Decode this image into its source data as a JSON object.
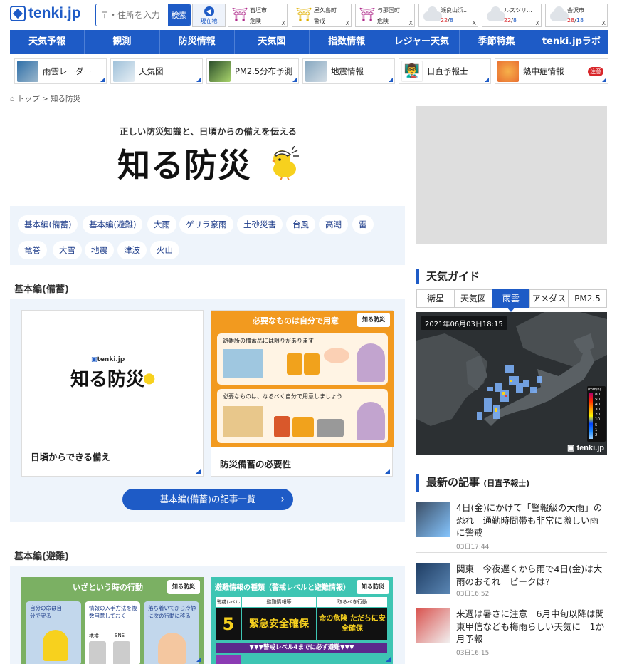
{
  "header": {
    "logo": "tenki.jp",
    "search_placeholder": "〒・住所を入力",
    "search_button": "検索",
    "location_button": "現在地"
  },
  "warnings": [
    {
      "place": "石垣市",
      "status": "危険",
      "type": "warn"
    },
    {
      "place": "屋久島町",
      "status": "警戒",
      "type": "warn"
    },
    {
      "place": "与那国町",
      "status": "危険",
      "type": "warn"
    },
    {
      "place": "瀬良山浜...",
      "high": "22",
      "low": "8",
      "type": "cloud"
    },
    {
      "place": "ルスツリ...",
      "high": "22",
      "low": "8",
      "type": "cloud"
    },
    {
      "place": "会沢市",
      "high": "28",
      "low": "18",
      "type": "cloud"
    }
  ],
  "close_mark": "X",
  "nav": [
    "天気予報",
    "観測",
    "防災情報",
    "天気図",
    "指数情報",
    "レジャー天気",
    "季節特集",
    "tenki.jpラボ"
  ],
  "subnav": [
    {
      "label": "雨雲レーダー"
    },
    {
      "label": "天気図"
    },
    {
      "label": "PM2.5分布予測"
    },
    {
      "label": "地震情報"
    },
    {
      "label": "日直予報士"
    },
    {
      "label": "熱中症情報",
      "badge": "注意"
    }
  ],
  "breadcrumb": {
    "home": "トップ",
    "sep": ">",
    "current": "知る防災"
  },
  "hero": {
    "subtitle": "正しい防災知識と、日頃からの備えを伝える",
    "title": "知る防災"
  },
  "tags": [
    "基本編(備蓄)",
    "基本編(避難)",
    "大雨",
    "ゲリラ豪雨",
    "土砂災害",
    "台風",
    "高潮",
    "雷",
    "竜巻",
    "大雪",
    "地震",
    "津波",
    "火山"
  ],
  "section1": {
    "heading": "基本編(備蓄)",
    "card1_caption": "日頃からできる備え",
    "card1_logo_small": "tenki.jp",
    "card1_logo": "知る防災",
    "card2_caption": "防災備蓄の必要性",
    "card2_banner": "必要なものは自分で用意",
    "card2_line1": "避難所の備蓄品には限りがあります",
    "card2_line2": "必要なものは、なるべく自分で用意しましょう",
    "card2_logo": "知る防災",
    "button": "基本編(備蓄)の記事一覧"
  },
  "section2": {
    "heading": "基本編(避難)",
    "card1_banner": "いざという時の行動",
    "card1_b1": "自分の命は自分で守る",
    "card1_b2": "情報の入手方法を複数用意しておく",
    "card1_b3": "落ち着いてから冷静に次の行動に移る",
    "card1_phone1": "携帯",
    "card1_phone2": "SNS",
    "card2_banner": "避難情報の種類（警戒レベルと避難情報）",
    "card2_h1": "警戒レベル",
    "card2_h2": "避難情報等",
    "card2_h3": "取るべき行動",
    "card2_level": "5",
    "card2_info": "緊急安全確保",
    "card2_action": "命の危険 ただちに安全確保",
    "card2_strip": "▼▼▼警戒レベル4までに必ず避難▼▼▼",
    "logo": "知る防災"
  },
  "guide": {
    "heading": "天気ガイド",
    "tabs": [
      "衛星",
      "天気図",
      "雨雲",
      "アメダス",
      "PM2.5"
    ],
    "active_tab": "雨雲",
    "map_time": "2021年06月03日18:15",
    "map_logo": "tenki.jp",
    "legend_unit": "(mm/h)",
    "legend": [
      "80",
      "50",
      "40",
      "30",
      "20",
      "10",
      "5",
      "1",
      "2"
    ]
  },
  "latest": {
    "heading": "最新の記事",
    "sub": "(日直予報士)",
    "articles": [
      {
        "title": "4日(金)にかけて「警報級の大雨」の恐れ　通勤時間帯も非常に激しい雨に警戒",
        "date": "03日17:44"
      },
      {
        "title": "関東　今夜遅くから雨で4日(金)は大雨のおそれ　ピークは?",
        "date": "03日16:52"
      },
      {
        "title": "来週は暑さに注意　6月中旬以降は関東甲信なども梅雨らしい天気に　1か月予報",
        "date": "03日16:15"
      }
    ]
  },
  "colors": {
    "accent": "#1e5bc6",
    "orange": "#f29a1f",
    "green": "#7bb063"
  }
}
